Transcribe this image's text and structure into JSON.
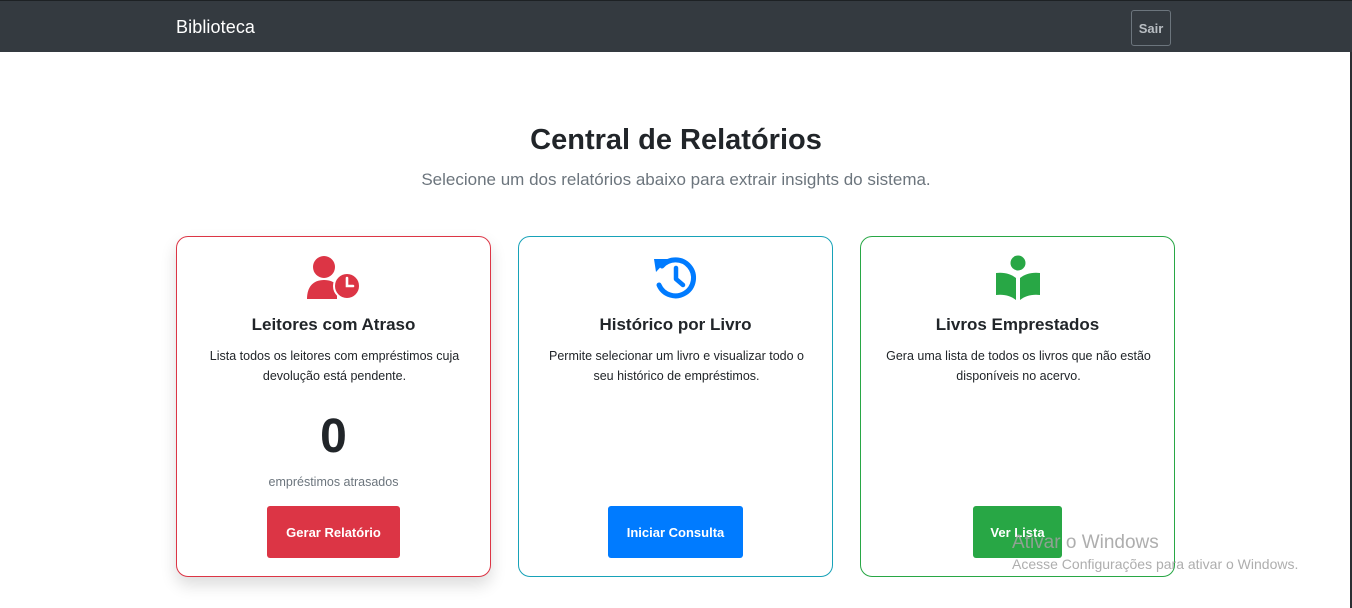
{
  "navbar": {
    "brand": "Biblioteca",
    "logout_label": "Sair"
  },
  "header": {
    "title": "Central de Relatórios",
    "subtitle": "Selecione um dos relatórios abaixo para extrair insights do sistema."
  },
  "cards": [
    {
      "icon": "user-clock-icon",
      "title": "Leitores com Atraso",
      "description": "Lista todos os leitores com empréstimos cuja devolução está pendente.",
      "count": "0",
      "count_label": "empréstimos atrasados",
      "button_label": "Gerar Relatório",
      "color": "#dc3545"
    },
    {
      "icon": "history-icon",
      "title": "Histórico por Livro",
      "description": "Permite selecionar um livro e visualizar todo o seu histórico de empréstimos.",
      "button_label": "Iniciar Consulta",
      "color": "#007bff"
    },
    {
      "icon": "book-reader-icon",
      "title": "Livros Emprestados",
      "description": "Gera uma lista de todos os livros que não estão disponíveis no acervo.",
      "button_label": "Ver Lista",
      "color": "#28a745"
    }
  ],
  "watermark": {
    "title": "Ativar o Windows",
    "subtitle": "Acesse Configurações para ativar o Windows."
  }
}
